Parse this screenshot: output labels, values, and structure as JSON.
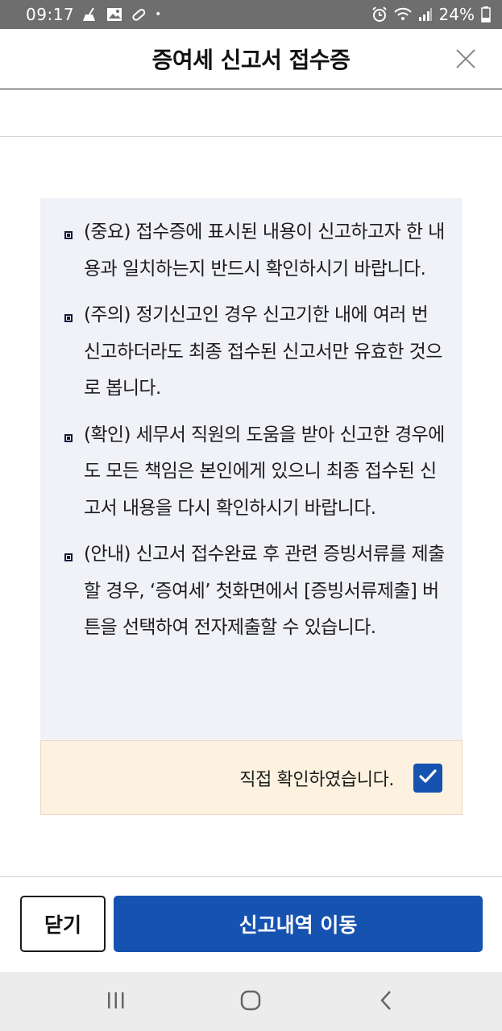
{
  "status_bar": {
    "time": "09:17",
    "dot": "•",
    "battery": "24%",
    "icons_left": [
      "broom-icon",
      "image-icon",
      "pill-icon"
    ],
    "icons_right": [
      "alarm-icon",
      "wifi-icon",
      "signal-icon",
      "battery-icon"
    ]
  },
  "header": {
    "title": "증여세 신고서 접수증",
    "close_icon": "close-icon"
  },
  "notices": [
    {
      "text": "(중요) 접수증에 표시된 내용이 신고하고자 한 내용과 일치하는지 반드시 확인하시기 바랍니다."
    },
    {
      "text": "(주의) 정기신고인 경우 신고기한 내에 여러 번 신고하더라도 최종 접수된 신고서만 유효한 것으로 봅니다."
    },
    {
      "text": "(확인) 세무서 직원의 도움을 받아 신고한 경우에도 모든 책임은 본인에게 있으니 최종 접수된 신고서 내용을 다시 확인하시기 바랍니다."
    },
    {
      "text": "(안내) 신고서 접수완료 후 관련 증빙서류를 제출할 경우, ‘증여세’ 첫화면에서 [증빙서류제출] 버튼을 선택하여 전자제출할 수 있습니다."
    }
  ],
  "confirm": {
    "label": "직접 확인하였습니다.",
    "checked": true
  },
  "buttons": {
    "close_label": "닫기",
    "move_label": "신고내역 이동"
  },
  "colors": {
    "primary": "#1652b0",
    "notice_bg": "#f1f2f8",
    "confirm_bg": "#fdf1e0"
  }
}
